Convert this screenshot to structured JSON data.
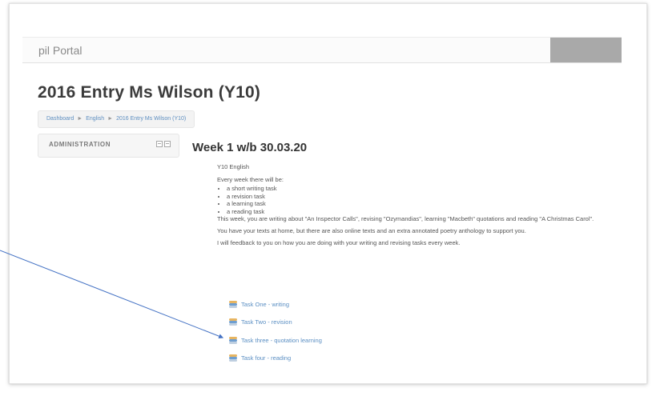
{
  "header": {
    "brand": "pil Portal"
  },
  "course": {
    "title": "2016 Entry Ms Wilson (Y10)"
  },
  "breadcrumb": {
    "items": [
      "Dashboard",
      "English",
      "2016 Entry Ms Wilson (Y10)"
    ],
    "separator": "►"
  },
  "admin": {
    "title": "ADMINISTRATION",
    "icons": [
      "dock-icon",
      "collapse-icon"
    ]
  },
  "section": {
    "title": "Week 1 w/b 30.03.20",
    "subject": "Y10 English",
    "intro": "Every week there will be:",
    "list": [
      "a short writing task",
      "a revision task",
      "a learning task",
      "a reading task"
    ],
    "paragraph1": "This week, you are writing about \"An Inspector Calls\", revising \"Ozymandias\", learning \"Macbeth\" quotations and reading \"A Christmas Carol\".",
    "paragraph2": "You have your texts at home, but there are also online texts and an extra annotated poetry anthology to support you.",
    "paragraph3": "I will feedback to you on how you are doing with your writing and revising tasks every week."
  },
  "tasks": [
    {
      "label": "Task One - writing",
      "icon": "assignment-icon"
    },
    {
      "label": "Task Two - revision",
      "icon": "assignment-icon"
    },
    {
      "label": "Task three - quotation learning",
      "icon": "assignment-icon"
    },
    {
      "label": "Task four - reading",
      "icon": "assignment-icon"
    }
  ],
  "annotation": {
    "arrow_color": "#4472c4"
  }
}
